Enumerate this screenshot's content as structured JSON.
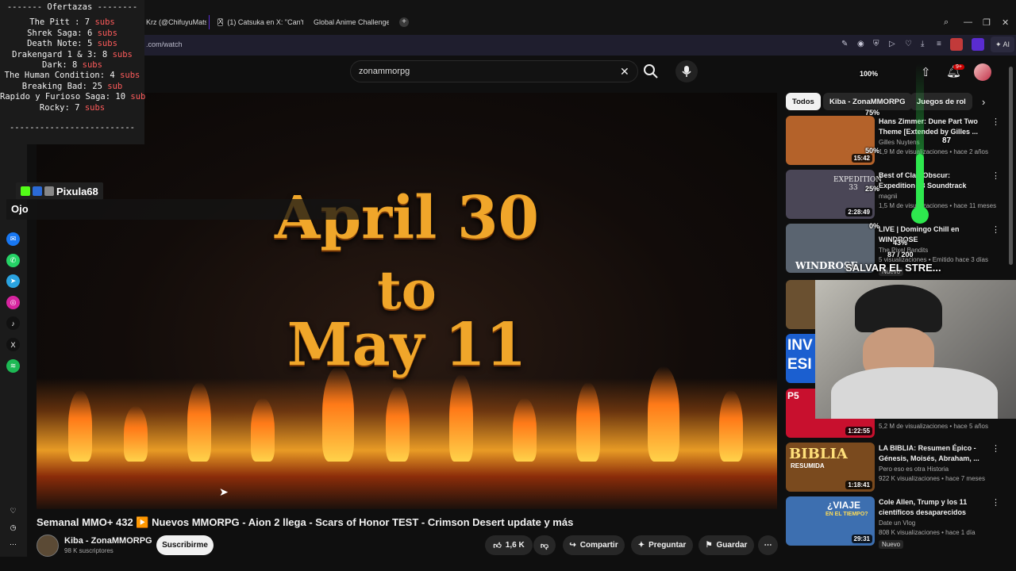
{
  "browser": {
    "tabs": [
      {
        "label": "Krz (@ChifuyuMats...",
        "color": "#3a3a3a"
      },
      {
        "label": "(1) Catsuka en X: \"Can't w...",
        "color": "#000000"
      },
      {
        "label": "Global Anime Challenge: (",
        "color": "#2b3a8a"
      }
    ],
    "new_tab": "+",
    "url": ".com/watch",
    "ai_label": "AI",
    "icons": [
      "edit-icon",
      "camera-icon",
      "shield-icon",
      "play-icon",
      "heart-icon",
      "download-icon",
      "menu-icon"
    ]
  },
  "offer_overlay": {
    "header": "------- Ofertazas --------",
    "items": [
      {
        "name": "The Pitt :",
        "count": "7",
        "unit": "subs"
      },
      {
        "name": "Shrek Saga:",
        "count": "6",
        "unit": "subs"
      },
      {
        "name": "Death Note:",
        "count": "5",
        "unit": "subs"
      },
      {
        "name": "Drakengard 1 & 3:",
        "count": "8",
        "unit": "subs"
      },
      {
        "name": "Dark:",
        "count": "8",
        "unit": "subs"
      },
      {
        "name": "The Human Condition:",
        "count": "4",
        "unit": "subs"
      },
      {
        "name": "Breaking Bad:",
        "count": "25",
        "unit": "sub"
      },
      {
        "name": "Rapido y Furioso Saga:",
        "count": "10",
        "unit": "sub"
      },
      {
        "name": "Rocky:",
        "count": "7",
        "unit": "subs"
      }
    ],
    "footer": "-------------------------"
  },
  "stream_overlay": {
    "username": "Pixula68",
    "ojo": "Ojo",
    "meter": {
      "top": "100%",
      "p75": "75%",
      "p50": "50%",
      "p25": "25%",
      "p0": "0%",
      "value": "87",
      "progress": "87 / 200",
      "pct_now": "43%",
      "level": 0.435
    },
    "banner": "SALVAR EL STRE..."
  },
  "search": {
    "query": "zonammorpg"
  },
  "notifications_badge": "9+",
  "video": {
    "line1": "April 30",
    "line2": "to",
    "line3": "May 11",
    "title": "Semanal MMO+ 432 ▶️ Nuevos MMORPG - Aion 2 llega - Scars of Honor TEST - Crimson Desert update y más"
  },
  "channel": {
    "name": "Kiba - ZonaMMORPG",
    "subs": "98 K suscriptores",
    "subscribe": "Suscribirme"
  },
  "actions": {
    "likes": "1,6 K",
    "share": "Compartir",
    "ask": "Preguntar",
    "save": "Guardar"
  },
  "chips": [
    "Todos",
    "Kiba - ZonaMMORPG",
    "Juegos de rol"
  ],
  "sidebar_videos": [
    {
      "title": "Hans Zimmer: Dune Part Two Theme [Extended by Gilles ...",
      "channel": "Gilles Nuytens",
      "meta": "1,9 M de visualizaciones • hace 2 años",
      "duration": "15:42",
      "bg": "#b4622a"
    },
    {
      "title": "Best of Clair Obscur: Expedition 33 Soundtrack",
      "channel": "magnii",
      "meta": "1,5 M de visualizaciones • hace 11 meses",
      "duration": "2:28:49",
      "bg": "#4a4656"
    },
    {
      "title": "LIVE | Domingo Chill en WINDROSE",
      "channel": "The Pixel Bandits",
      "meta": "5 visualizaciones • Emitido hace 3 días",
      "duration": "",
      "badge": "Nuevo",
      "bg": "#5a6470"
    },
    {
      "title": "",
      "channel": "",
      "meta": "",
      "duration": "",
      "bg": "#6a5030"
    },
    {
      "title": "",
      "channel": "",
      "meta": "",
      "duration": "",
      "bg": "#1b5fd0"
    },
    {
      "title": "",
      "channel": "",
      "meta": "5,2 M de visualizaciones • hace 5 años",
      "duration": "1:22:55",
      "bg": "#c8102e"
    },
    {
      "title": "LA BIBLIA: Resumen Épico - Génesis, Moisés, Abraham, ...",
      "channel": "Pero eso es otra Historia",
      "meta": "922 K visualizaciones • hace 7 meses",
      "duration": "1:18:41",
      "bg": "#7a4a1e"
    },
    {
      "title": "Cole Allen, Trump y los 11 científicos desaparecidos",
      "channel": "Date un Vlog",
      "meta": "808 K visualizaciones • hace 1 día",
      "duration": "29:31",
      "badge": "Nuevo",
      "bg": "#3d6fb0"
    }
  ],
  "thumb_texts": {
    "expedition": "EXPEDITION 33",
    "windrose": "WINDROSE",
    "inv": "INV",
    "esi": "ESI",
    "persona": "P5",
    "biblia": "BIBLIA",
    "biblia_sub": "RESUMIDA",
    "viaje": "¿VIAJE",
    "viaje_sub": "EN EL TIEMPO?"
  }
}
